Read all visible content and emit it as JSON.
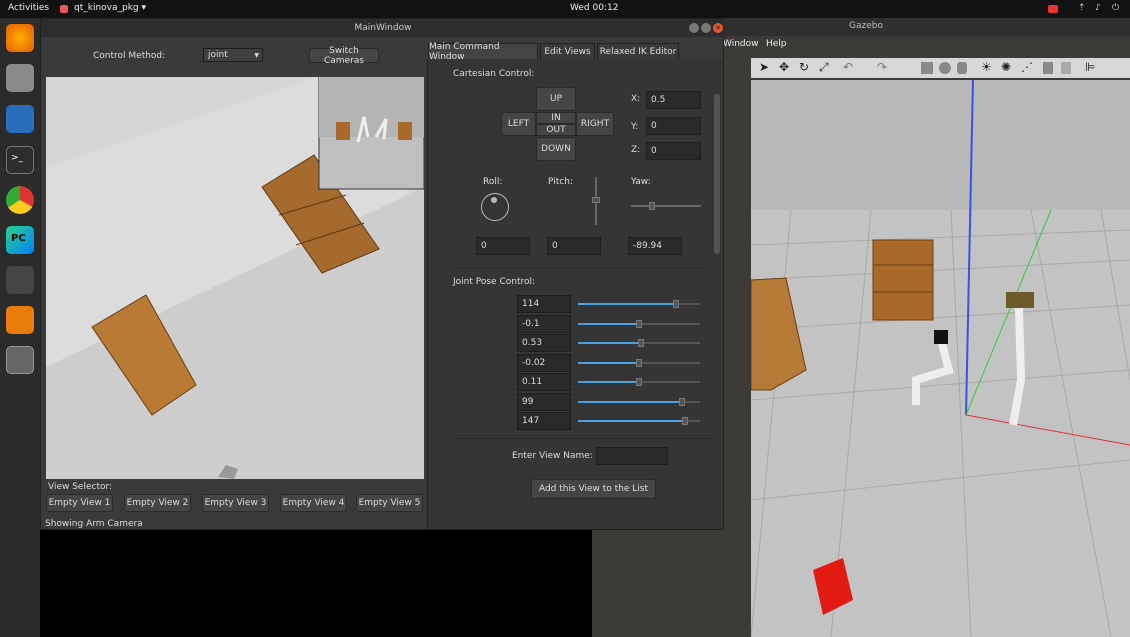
{
  "topbar": {
    "activities": "Activities",
    "app": "qt_kinova_pkg ▾",
    "clock": "Wed 00:12"
  },
  "dock": {
    "icons": [
      "firefox-icon",
      "files-icon",
      "writer-icon",
      "terminal-icon",
      "chrome-icon",
      "pycharm-icon",
      "inkscape-icon",
      "blender-icon",
      "ros-icon"
    ]
  },
  "gazebo": {
    "title": "Gazebo",
    "menu": [
      "Window",
      "Help"
    ]
  },
  "main_window": {
    "title": "MainWindow",
    "control_method_label": "Control Method:",
    "control_method_value": "joint",
    "switch_cameras": "Switch Cameras",
    "view_selector_label": "View Selector:",
    "views": [
      "Empty View 1",
      "Empty View 2",
      "Empty View 3",
      "Empty View 4",
      "Empty View 5"
    ],
    "status": "Showing Arm Camera"
  },
  "tabs": [
    "Main Command Window",
    "Edit Views",
    "Relaxed IK Editor"
  ],
  "cartesian": {
    "label": "Cartesian Control:",
    "up": "UP",
    "down": "DOWN",
    "left": "LEFT",
    "right": "RIGHT",
    "in": "IN",
    "out": "OUT",
    "x_label": "X:",
    "x": "0.5",
    "y_label": "Y:",
    "y": "0",
    "z_label": "Z:",
    "z": "0",
    "roll_label": "Roll:",
    "pitch_label": "Pitch:",
    "yaw_label": "Yaw:",
    "roll": "0",
    "pitch": "0",
    "yaw": "-89.94"
  },
  "joints": {
    "label": "Joint Pose Control:",
    "values": [
      "114",
      "-0.1",
      "0.53",
      "-0.02",
      "0.11",
      "99",
      "147"
    ],
    "levels": [
      0.8,
      0.5,
      0.52,
      0.5,
      0.5,
      0.85,
      0.88
    ]
  },
  "view_name": {
    "label": "Enter View Name:",
    "value": "",
    "add": "Add this View to the List"
  },
  "colors": {
    "accent": "#4aa3df",
    "bg": "#3a3a3a"
  }
}
